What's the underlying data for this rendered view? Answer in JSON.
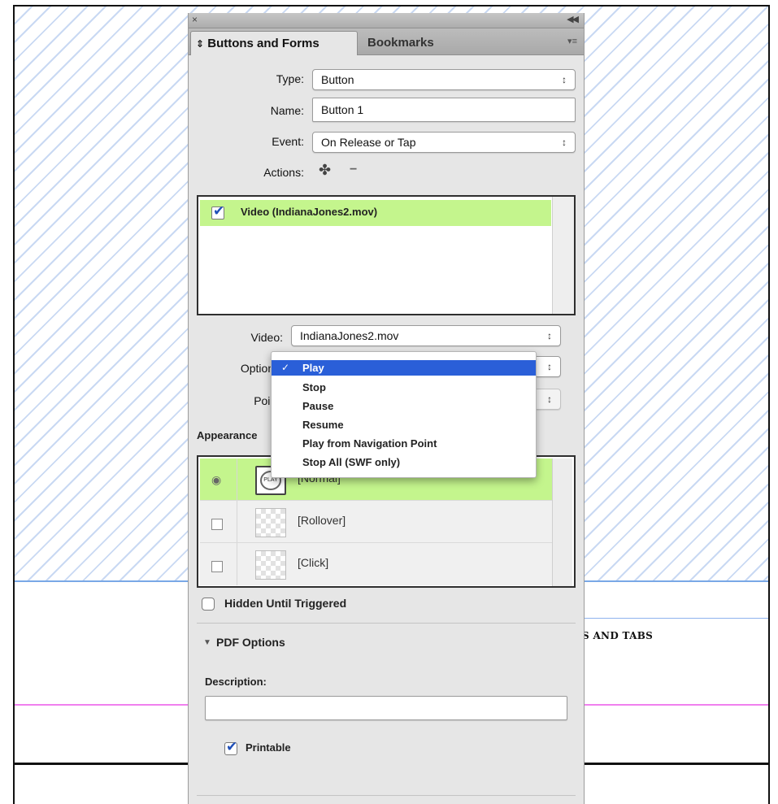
{
  "canvas": {
    "tabs_text": "S AND TABS"
  },
  "panel": {
    "tabs": [
      "Buttons and Forms",
      "Bookmarks"
    ],
    "tab_prefix_icon": "⇕",
    "close_glyph": "×",
    "collapse_glyph": "◀◀",
    "menu_glyph": "▾≡"
  },
  "form": {
    "type_label": "Type:",
    "type_value": "Button",
    "name_label": "Name:",
    "name_value": "Button 1",
    "event_label": "Event:",
    "event_value": "On Release or Tap",
    "actions_label": "Actions:",
    "add_action_glyph": "✤",
    "remove_action_glyph": "−"
  },
  "actions_list": {
    "items": [
      {
        "label": "Video (IndianaJones2.mov)",
        "checked": true
      }
    ]
  },
  "video": {
    "video_label": "Video:",
    "video_value": "IndianaJones2.mov",
    "options_label": "Options:",
    "point_label": "Point:",
    "point_value": ""
  },
  "options_menu": {
    "items": [
      "Play",
      "Stop",
      "Pause",
      "Resume",
      "Play from Navigation Point",
      "Stop All (SWF only)"
    ],
    "selected": "Play",
    "check_glyph": "✓"
  },
  "appearance": {
    "label": "Appearance",
    "states": [
      "[Normal]",
      "[Rollover]",
      "[Click]"
    ],
    "normal_thumb_text": "PLAY",
    "normal_visibility_glyph": "◉"
  },
  "hidden_until_triggered": {
    "label": "Hidden Until Triggered",
    "checked": false
  },
  "pdf_options": {
    "label": "PDF Options",
    "disclosure_glyph": "▼",
    "description_label": "Description:",
    "description_value": "",
    "printable_label": "Printable",
    "printable_checked": true
  },
  "colors": {
    "selection_green": "#c4f58d",
    "menu_highlight": "#2a5fd8",
    "stripe_blue": "#c9d9f3",
    "guide_magenta": "#f080ee",
    "guide_blue": "#7aa8e6"
  }
}
